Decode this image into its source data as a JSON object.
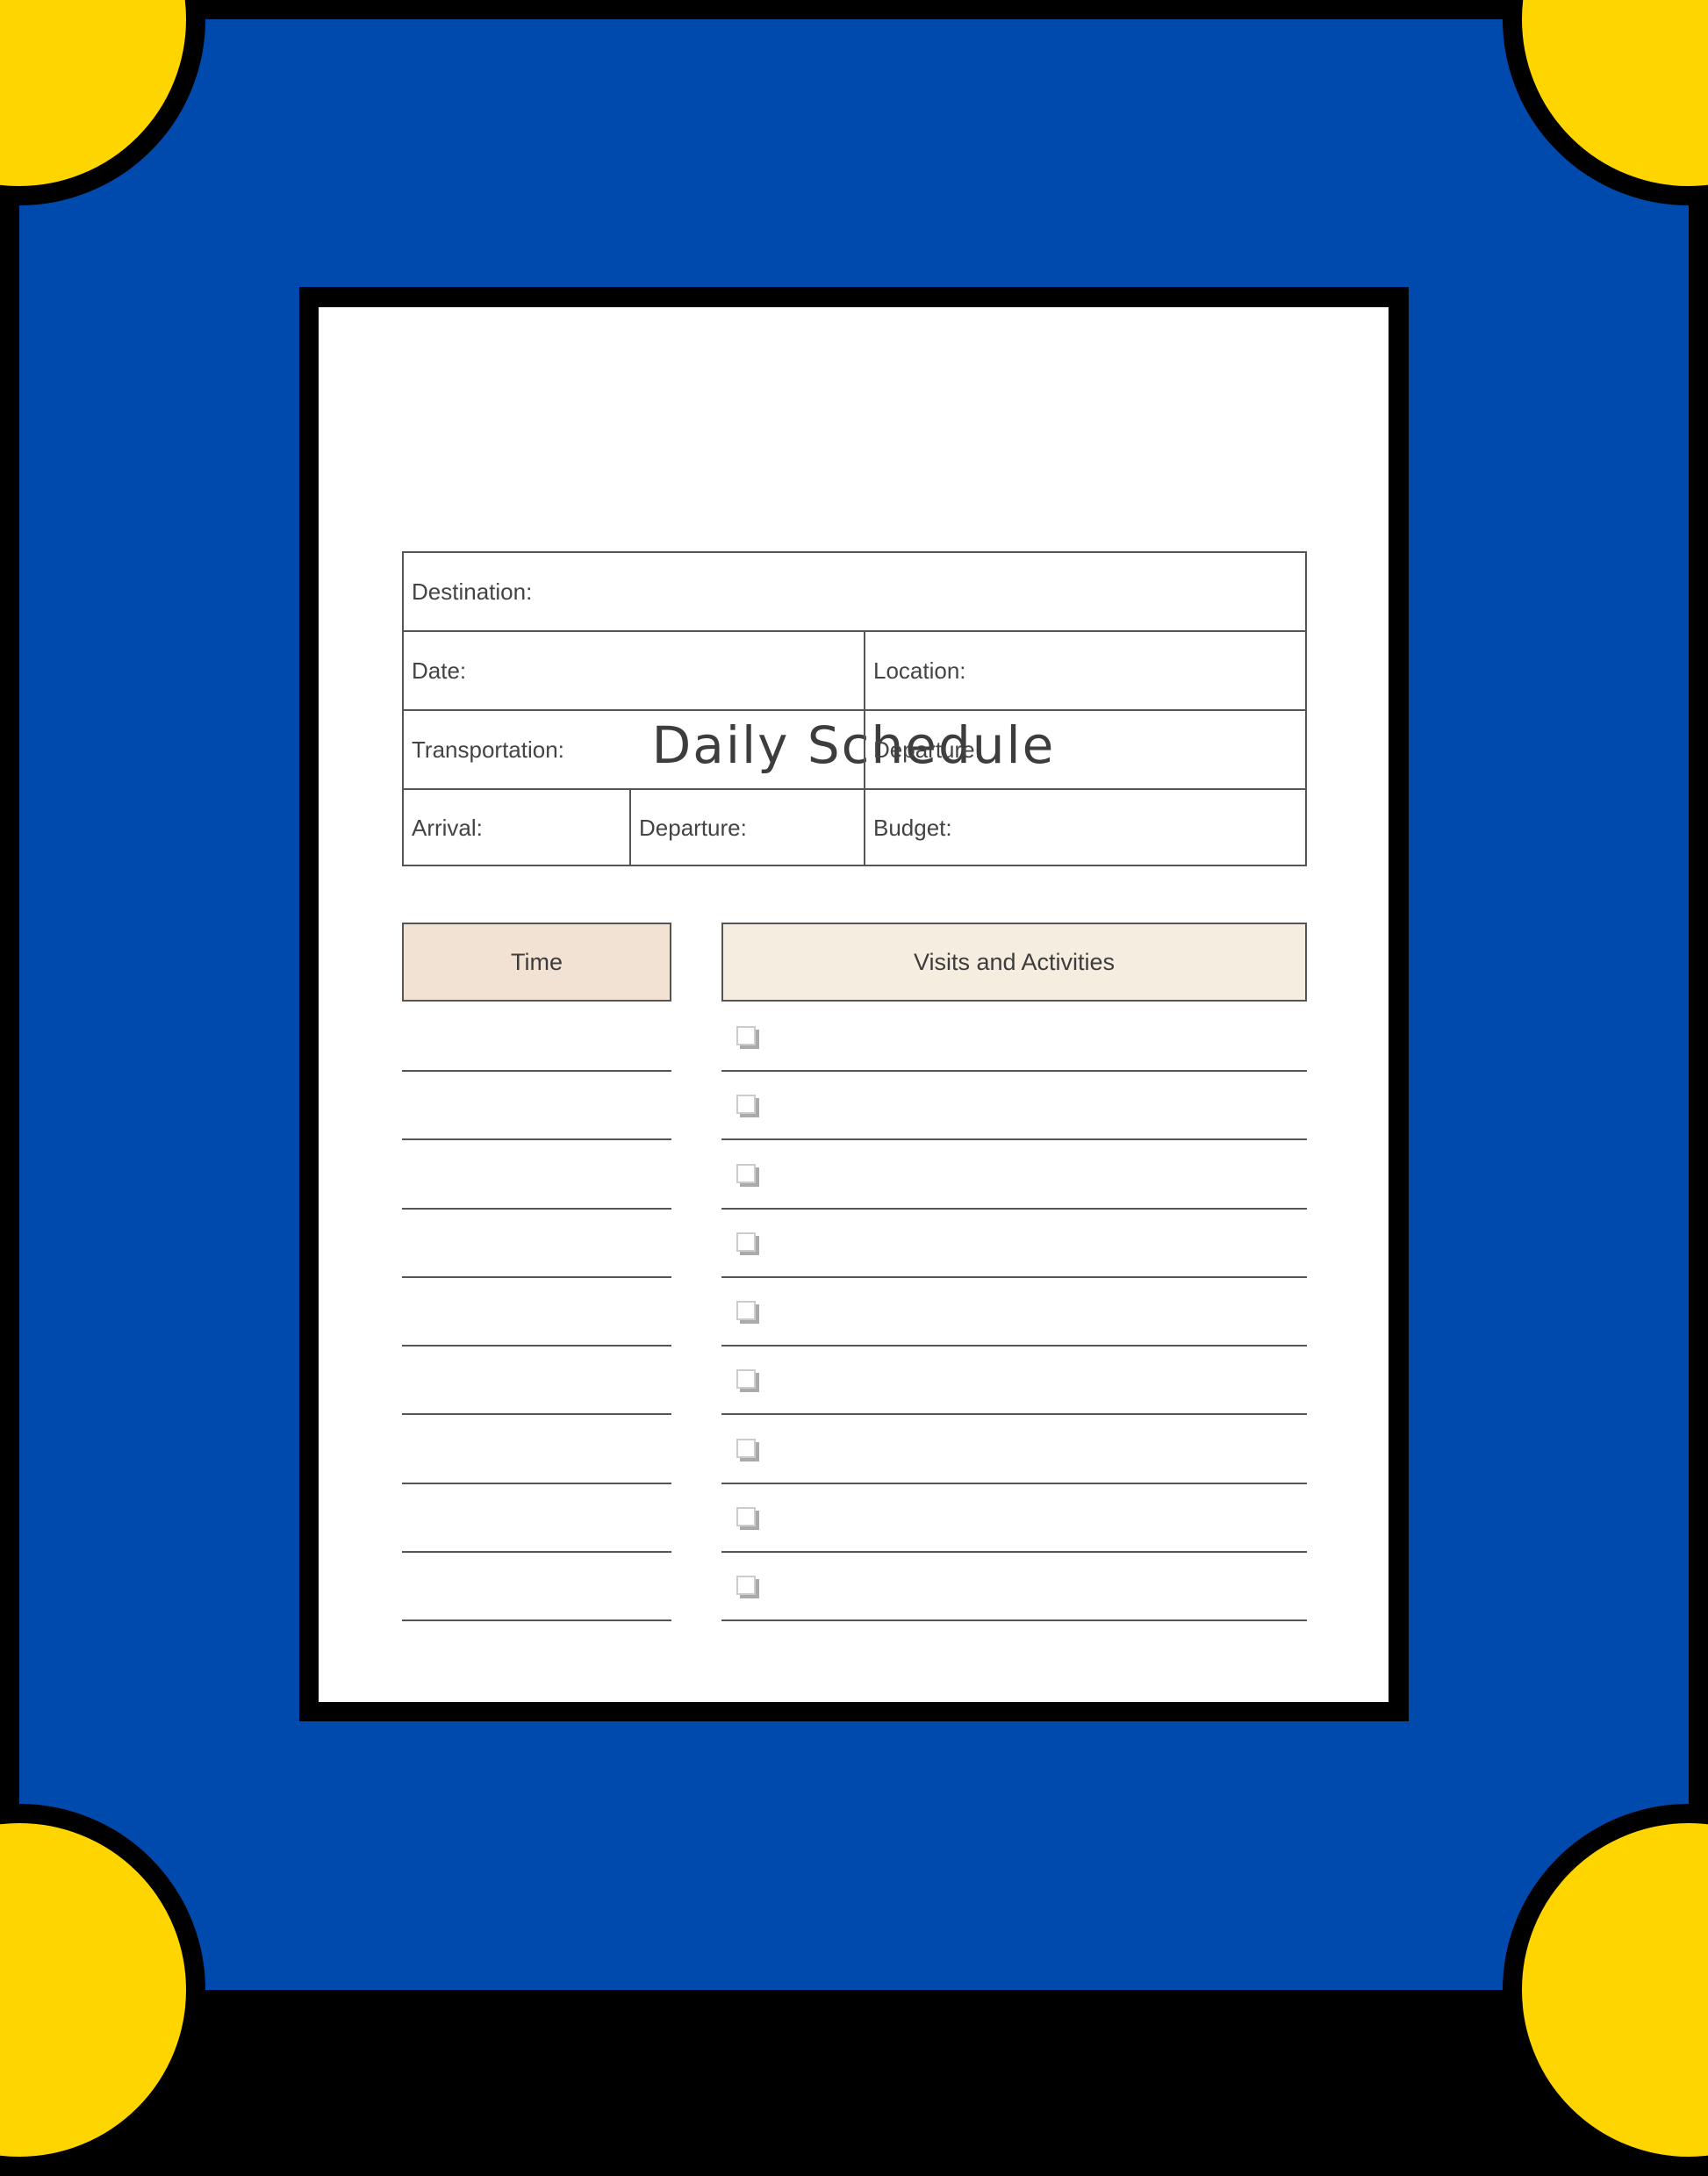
{
  "colors": {
    "background": "#004aad",
    "corner_accent": "#ffd500",
    "border": "#000000",
    "time_header": "#f2e2d4",
    "visits_header": "#f4ede0"
  },
  "title": "Daily Schedule",
  "info_fields": {
    "destination": "Destination:",
    "date": "Date:",
    "location": "Location:",
    "transportation": "Transportation:",
    "departure_right": "Departure:",
    "arrival": "Arrival:",
    "departure_mid": "Departure:",
    "budget": "Budget:"
  },
  "schedule": {
    "time_header": "Time",
    "visits_header": "Visits and Activities",
    "row_count": 9,
    "checkbox_icon": "checkbox-icon"
  }
}
